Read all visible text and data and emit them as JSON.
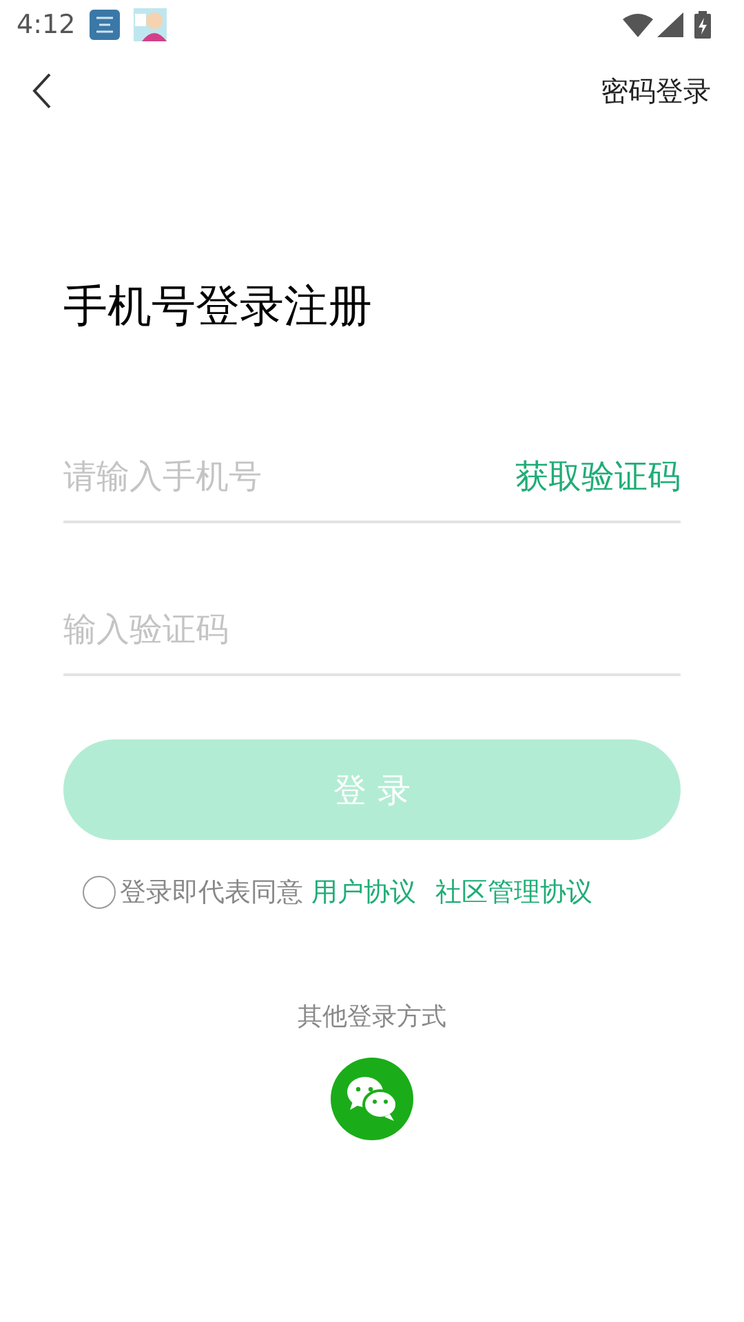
{
  "status_bar": {
    "time": "4:12"
  },
  "header": {
    "action": "密码登录"
  },
  "title": "手机号登录注册",
  "phone_field": {
    "placeholder": "请输入手机号",
    "action": "获取验证码"
  },
  "code_field": {
    "placeholder": "输入验证码"
  },
  "login_button": {
    "label": "登 录",
    "disabled": true
  },
  "agreement": {
    "checked": false,
    "text": "登录即代表同意",
    "links": [
      "用户协议",
      "社区管理协议"
    ]
  },
  "other_login": {
    "label": "其他登录方式"
  }
}
